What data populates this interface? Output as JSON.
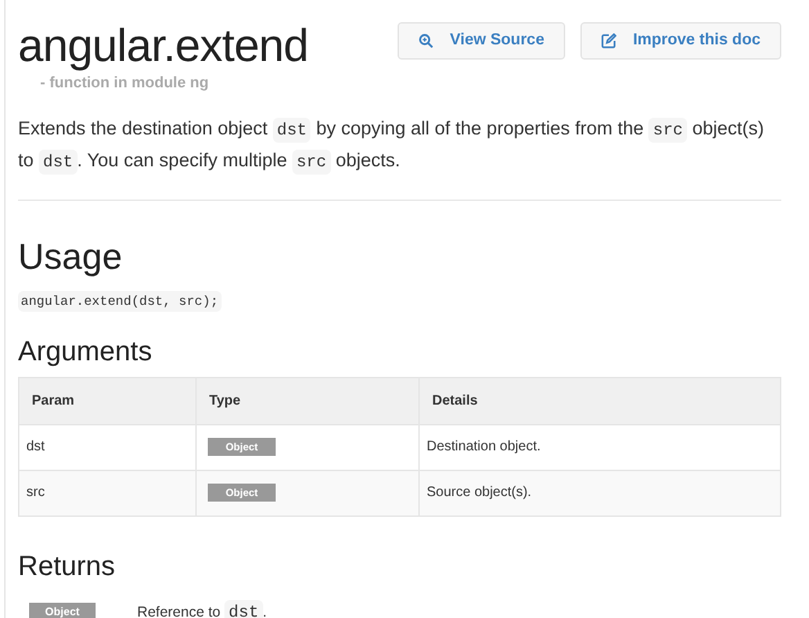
{
  "title": "angular.extend",
  "subtitle": "- function in module ng",
  "buttons": [
    {
      "label": "View Source",
      "kind": "search"
    },
    {
      "label": "Improve this doc",
      "kind": "edit"
    }
  ],
  "description": [
    {
      "kind": "text",
      "text": "Extends the destination object "
    },
    {
      "kind": "code",
      "text": "dst"
    },
    {
      "kind": "text",
      "text": " by copying all of the properties from the "
    },
    {
      "kind": "code",
      "text": "src"
    },
    {
      "kind": "text",
      "text": " object(s) to "
    },
    {
      "kind": "code",
      "text": "dst"
    },
    {
      "kind": "text",
      "text": ". You can specify multiple "
    },
    {
      "kind": "code",
      "text": "src"
    },
    {
      "kind": "text",
      "text": " objects."
    }
  ],
  "usage": {
    "heading": "Usage",
    "code": "angular.extend(dst, src);"
  },
  "arguments": {
    "heading": "Arguments",
    "columns": [
      "Param",
      "Type",
      "Details"
    ],
    "rows": [
      {
        "param": "dst",
        "type": "Object",
        "details": "Destination object."
      },
      {
        "param": "src",
        "type": "Object",
        "details": "Source object(s)."
      }
    ]
  },
  "returns": {
    "heading": "Returns",
    "type": "Object",
    "details": [
      {
        "kind": "text",
        "text": "Reference to "
      },
      {
        "kind": "code",
        "text": "dst"
      },
      {
        "kind": "text",
        "text": "."
      }
    ]
  }
}
